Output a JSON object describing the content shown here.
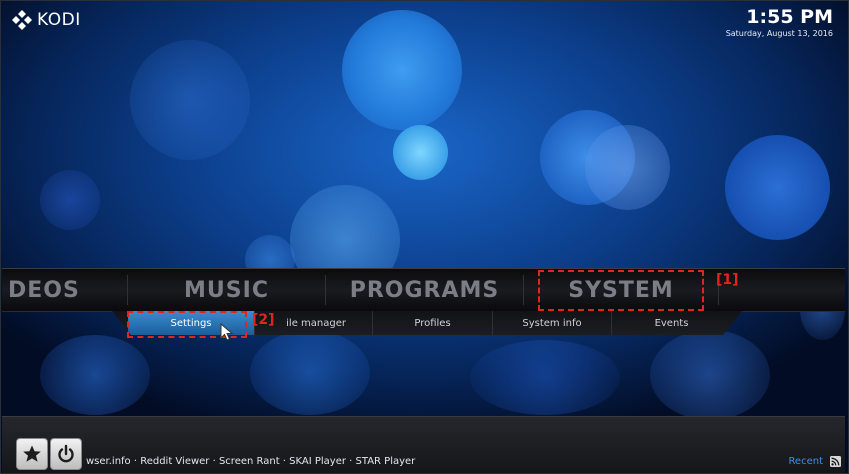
{
  "header": {
    "logo_text": "KODI",
    "time": "1:55 PM",
    "date": "Saturday, August 13, 2016"
  },
  "main_menu": {
    "items": [
      {
        "label": "DEOS"
      },
      {
        "label": "MUSIC"
      },
      {
        "label": "PROGRAMS"
      },
      {
        "label": "SYSTEM"
      }
    ]
  },
  "sub_menu": {
    "items": [
      {
        "label": "Settings"
      },
      {
        "label": "ile manager"
      },
      {
        "label": "Profiles"
      },
      {
        "label": "System info"
      },
      {
        "label": "Events"
      }
    ]
  },
  "annotations": {
    "system_tag": "[1]",
    "settings_tag": "[2]",
    "color": "#e0251e"
  },
  "bottom": {
    "favourites_icon": "star-icon",
    "power_icon": "power-icon",
    "ticker": "wser.info · Reddit Viewer · Screen Rant · SKAI Player · STAR Player",
    "recent_label": "Recent",
    "rss_icon": "rss-icon"
  },
  "colors": {
    "accent": "#3d8fe6",
    "selected_tab": "#2a73b5"
  }
}
